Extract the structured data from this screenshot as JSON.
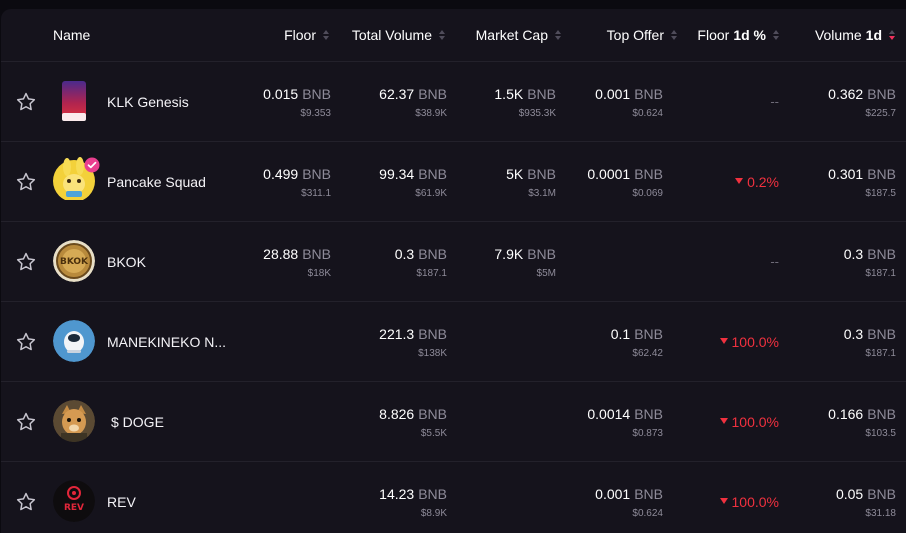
{
  "header": {
    "name": "Name",
    "floor": "Floor",
    "total_volume": "Total Volume",
    "market_cap": "Market Cap",
    "top_offer": "Top Offer",
    "floor_change_prefix": "Floor",
    "floor_change_suffix": "1d %",
    "volume_prefix": "Volume",
    "volume_suffix": "1d"
  },
  "unit": "BNB",
  "rows": [
    {
      "name": "KLK Genesis",
      "floor": "0.015",
      "floor_usd": "$9.353",
      "total_volume": "62.37",
      "total_volume_usd": "$38.9K",
      "market_cap": "1.5K",
      "market_cap_usd": "$935.3K",
      "top_offer": "0.001",
      "top_offer_usd": "$0.624",
      "floor_change": "--",
      "volume": "0.362",
      "volume_usd": "$225.7"
    },
    {
      "name": "Pancake Squad",
      "floor": "0.499",
      "floor_usd": "$311.1",
      "total_volume": "99.34",
      "total_volume_usd": "$61.9K",
      "market_cap": "5K",
      "market_cap_usd": "$3.1M",
      "top_offer": "0.0001",
      "top_offer_usd": "$0.069",
      "floor_change": "0.2%",
      "volume": "0.301",
      "volume_usd": "$187.5"
    },
    {
      "name": "BKOK",
      "avatar_text": "BKOK",
      "floor": "28.88",
      "floor_usd": "$18K",
      "total_volume": "0.3",
      "total_volume_usd": "$187.1",
      "market_cap": "7.9K",
      "market_cap_usd": "$5M",
      "floor_change": "--",
      "volume": "0.3",
      "volume_usd": "$187.1"
    },
    {
      "name": "MANEKINEKO N...",
      "total_volume": "221.3",
      "total_volume_usd": "$138K",
      "top_offer": "0.1",
      "top_offer_usd": "$62.42",
      "floor_change": "100.0%",
      "volume": "0.3",
      "volume_usd": "$187.1"
    },
    {
      "name": "$ DOGE",
      "total_volume": "8.826",
      "total_volume_usd": "$5.5K",
      "top_offer": "0.0014",
      "top_offer_usd": "$0.873",
      "floor_change": "100.0%",
      "volume": "0.166",
      "volume_usd": "$103.5"
    },
    {
      "name": "REV",
      "avatar_text": "REV",
      "total_volume": "14.23",
      "total_volume_usd": "$8.9K",
      "top_offer": "0.001",
      "top_offer_usd": "$0.624",
      "floor_change": "100.0%",
      "volume": "0.05",
      "volume_usd": "$31.18"
    }
  ],
  "colors": {
    "negative": "#f0313f",
    "accent": "#f0305c",
    "verified": "#e83f8f"
  }
}
